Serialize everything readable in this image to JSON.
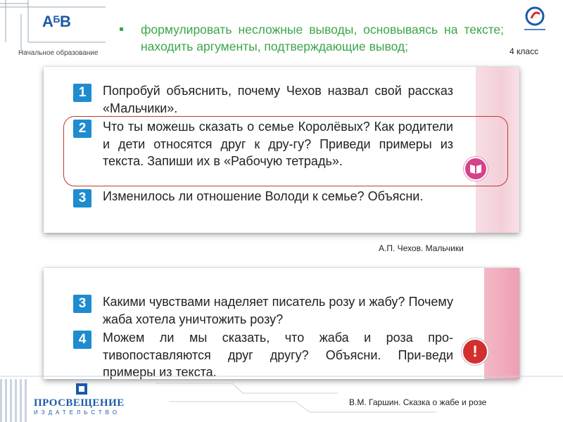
{
  "header": {
    "logo_main": "А",
    "logo_sup": "Б",
    "logo_end": "В",
    "edu_label": "Начальное образование",
    "objective": "формулировать несложные выводы, основываясь на тексте; находить аргументы, подтверждающие вывод;",
    "grade": "4 класс"
  },
  "card1": {
    "questions": [
      {
        "num": "1",
        "text": "Попробуй объяснить, почему Чехов назвал свой рассказ «Мальчики»."
      },
      {
        "num": "2",
        "text": "Что ты можешь сказать о семье Королёвых? Как родители и дети относятся друг к дру-гу? Приведи примеры из текста. Запиши их в «Рабочую тетрадь»."
      },
      {
        "num": "3",
        "text": "Изменилось ли отношение Володи к семье? Объясни."
      }
    ],
    "caption": "А.П. Чехов. Мальчики"
  },
  "card2": {
    "questions": [
      {
        "num": "3",
        "text": "Какими чувствами наделяет писатель розу и жабу? Почему жаба хотела уничтожить розу?"
      },
      {
        "num": "4",
        "text": "Можем ли мы сказать, что жаба и роза про-тивопоставляются друг другу? Объясни. При-веди примеры из текста."
      }
    ],
    "caption": "В.М. Гаршин. Сказка о жабе и розе",
    "warn_symbol": "!"
  },
  "footer": {
    "publisher": "ПРОСВЕЩЕНИЕ",
    "publisher_sub": "ИЗДАТЕЛЬСТВО"
  },
  "colors": {
    "objective": "#3aa648",
    "number_badge": "#1e8ccf",
    "highlight": "#c0392b",
    "brand": "#1a5aa8"
  }
}
